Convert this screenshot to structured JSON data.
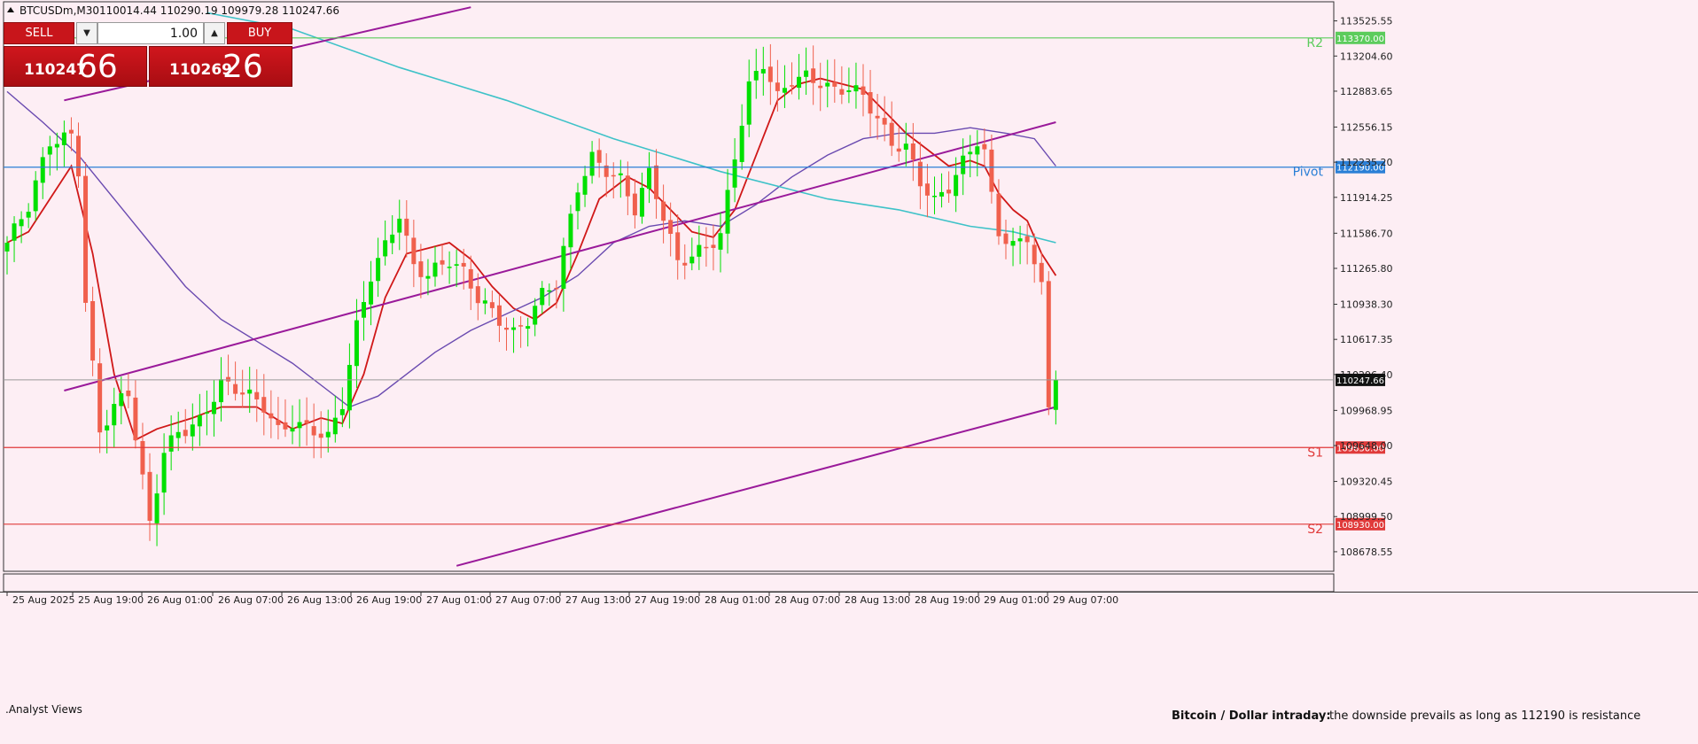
{
  "header": {
    "symbol": "BTCUSDm,M30",
    "ohlc": "110014.44 110290.19 109979.28 110247.66"
  },
  "trade_panel": {
    "sell_label": "SELL",
    "buy_label": "BUY",
    "lot": "1.00",
    "sell_small": "110247",
    "sell_big": "66",
    "buy_small": "110269",
    "buy_big": "26"
  },
  "indicator_label": ".Analyst Views",
  "footer": {
    "title": "Bitcoin / Dollar intraday:",
    "text": "the downside prevails as long as 112190 is resistance"
  },
  "colors": {
    "background": "#fdeef4",
    "bull": "#00e000",
    "bear": "#f0604d",
    "ema_fast": "#d01818",
    "ma_mid": "#6a4ab0",
    "ma_slow": "#3ec2c8",
    "channel": "#9a1a9a",
    "r2": "#5ccc5c",
    "pivot": "#2a7fd6",
    "support": "#e03a3a"
  },
  "chart_data": {
    "type": "candlestick",
    "symbol": "BTCUSDm",
    "timeframe": "M30",
    "ylim": [
      108500,
      113700
    ],
    "y_ticks": [
      "113525.55",
      "113204.60",
      "112883.65",
      "112556.15",
      "112235.20",
      "111914.25",
      "111586.70",
      "111265.80",
      "110938.30",
      "110617.35",
      "110296.40",
      "109968.95",
      "109648.00",
      "109320.45",
      "108999.50",
      "108678.55"
    ],
    "x_ticks": [
      "25 Aug 2025",
      "25 Aug 19:00",
      "26 Aug 01:00",
      "26 Aug 07:00",
      "26 Aug 13:00",
      "26 Aug 19:00",
      "27 Aug 01:00",
      "27 Aug 07:00",
      "27 Aug 13:00",
      "27 Aug 19:00",
      "28 Aug 01:00",
      "28 Aug 07:00",
      "28 Aug 13:00",
      "28 Aug 19:00",
      "29 Aug 01:00",
      "29 Aug 07:00"
    ],
    "last_price": "110247.66",
    "levels": [
      {
        "name": "R2",
        "value": 113370.0,
        "label": "113370.00",
        "color": "#5ccc5c"
      },
      {
        "name": "Pivot",
        "value": 112190.0,
        "label": "112190.00",
        "color": "#2a7fd6"
      },
      {
        "name": "S1",
        "value": 109630.0,
        "label": "109630.00",
        "color": "#e03a3a"
      },
      {
        "name": "S2",
        "value": 108930.0,
        "label": "108930.00",
        "color": "#e03a3a"
      }
    ],
    "candles_count": 148,
    "anchors": [
      [
        0,
        111500
      ],
      [
        3,
        111800
      ],
      [
        6,
        112400
      ],
      [
        9,
        112500
      ],
      [
        10,
        112200
      ],
      [
        11,
        111000
      ],
      [
        12,
        110400
      ],
      [
        13,
        109800
      ],
      [
        15,
        110000
      ],
      [
        17,
        110100
      ],
      [
        19,
        109300
      ],
      [
        20,
        108900
      ],
      [
        22,
        109600
      ],
      [
        24,
        109800
      ],
      [
        27,
        109900
      ],
      [
        30,
        110200
      ],
      [
        33,
        110100
      ],
      [
        36,
        110000
      ],
      [
        38,
        109800
      ],
      [
        40,
        109900
      ],
      [
        43,
        109800
      ],
      [
        45,
        109700
      ],
      [
        47,
        110000
      ],
      [
        49,
        110700
      ],
      [
        51,
        111200
      ],
      [
        53,
        111500
      ],
      [
        55,
        111800
      ],
      [
        57,
        111300
      ],
      [
        59,
        111200
      ],
      [
        62,
        111300
      ],
      [
        64,
        111200
      ],
      [
        66,
        111000
      ],
      [
        68,
        110900
      ],
      [
        71,
        110700
      ],
      [
        73,
        110800
      ],
      [
        75,
        111000
      ],
      [
        77,
        111100
      ],
      [
        80,
        112000
      ],
      [
        82,
        112300
      ],
      [
        84,
        112200
      ],
      [
        86,
        112100
      ],
      [
        88,
        111800
      ],
      [
        90,
        112100
      ],
      [
        92,
        111700
      ],
      [
        94,
        111300
      ],
      [
        96,
        111400
      ],
      [
        98,
        111500
      ],
      [
        100,
        111600
      ],
      [
        102,
        112300
      ],
      [
        104,
        112900
      ],
      [
        106,
        113100
      ],
      [
        108,
        112800
      ],
      [
        110,
        113000
      ],
      [
        112,
        113050
      ],
      [
        114,
        113000
      ],
      [
        116,
        112900
      ],
      [
        118,
        112900
      ],
      [
        120,
        112800
      ],
      [
        122,
        112600
      ],
      [
        124,
        112400
      ],
      [
        126,
        112400
      ],
      [
        128,
        112100
      ],
      [
        130,
        111900
      ],
      [
        132,
        112000
      ],
      [
        134,
        112200
      ],
      [
        136,
        112400
      ],
      [
        137,
        112300
      ],
      [
        138,
        111900
      ],
      [
        139,
        111600
      ],
      [
        141,
        111500
      ],
      [
        143,
        111600
      ],
      [
        145,
        111100
      ],
      [
        146,
        110000
      ],
      [
        147,
        110247.66
      ]
    ],
    "series": [
      {
        "id": "ema_fast",
        "color": "#d01818",
        "values": [
          [
            0,
            111500
          ],
          [
            3,
            111600
          ],
          [
            6,
            111900
          ],
          [
            9,
            112200
          ],
          [
            12,
            111400
          ],
          [
            15,
            110300
          ],
          [
            18,
            109700
          ],
          [
            21,
            109800
          ],
          [
            26,
            109900
          ],
          [
            30,
            110000
          ],
          [
            35,
            110000
          ],
          [
            40,
            109800
          ],
          [
            44,
            109900
          ],
          [
            47,
            109850
          ],
          [
            50,
            110300
          ],
          [
            53,
            111000
          ],
          [
            56,
            111400
          ],
          [
            59,
            111450
          ],
          [
            62,
            111500
          ],
          [
            65,
            111350
          ],
          [
            68,
            111100
          ],
          [
            71,
            110900
          ],
          [
            74,
            110800
          ],
          [
            77,
            110950
          ],
          [
            80,
            111400
          ],
          [
            83,
            111900
          ],
          [
            87,
            112100
          ],
          [
            90,
            112000
          ],
          [
            93,
            111800
          ],
          [
            96,
            111600
          ],
          [
            99,
            111550
          ],
          [
            102,
            111800
          ],
          [
            105,
            112300
          ],
          [
            108,
            112800
          ],
          [
            111,
            112950
          ],
          [
            114,
            113000
          ],
          [
            117,
            112950
          ],
          [
            120,
            112900
          ],
          [
            123,
            112700
          ],
          [
            126,
            112500
          ],
          [
            129,
            112350
          ],
          [
            132,
            112200
          ],
          [
            135,
            112250
          ],
          [
            137,
            112200
          ],
          [
            139,
            111950
          ],
          [
            141,
            111800
          ],
          [
            143,
            111700
          ],
          [
            145,
            111400
          ],
          [
            147,
            111200
          ]
        ]
      },
      {
        "id": "ma_mid",
        "color": "#6a4ab0",
        "values": [
          [
            0,
            112880
          ],
          [
            5,
            112600
          ],
          [
            10,
            112300
          ],
          [
            15,
            111900
          ],
          [
            20,
            111500
          ],
          [
            25,
            111100
          ],
          [
            30,
            110800
          ],
          [
            35,
            110600
          ],
          [
            40,
            110400
          ],
          [
            45,
            110150
          ],
          [
            48,
            110000
          ],
          [
            52,
            110100
          ],
          [
            56,
            110300
          ],
          [
            60,
            110500
          ],
          [
            65,
            110700
          ],
          [
            70,
            110850
          ],
          [
            75,
            111000
          ],
          [
            80,
            111200
          ],
          [
            85,
            111500
          ],
          [
            90,
            111650
          ],
          [
            95,
            111700
          ],
          [
            100,
            111650
          ],
          [
            105,
            111850
          ],
          [
            110,
            112100
          ],
          [
            115,
            112300
          ],
          [
            120,
            112450
          ],
          [
            125,
            112500
          ],
          [
            130,
            112500
          ],
          [
            135,
            112550
          ],
          [
            140,
            112500
          ],
          [
            144,
            112450
          ],
          [
            147,
            112200
          ]
        ]
      },
      {
        "id": "ma_slow",
        "color": "#3ec2c8",
        "values": [
          [
            28,
            113600
          ],
          [
            40,
            113450
          ],
          [
            55,
            113100
          ],
          [
            70,
            112800
          ],
          [
            85,
            112450
          ],
          [
            100,
            112150
          ],
          [
            115,
            111900
          ],
          [
            125,
            111800
          ],
          [
            135,
            111650
          ],
          [
            141,
            111600
          ],
          [
            147,
            111500
          ]
        ]
      },
      {
        "id": "channel_upper",
        "color": "#9a1a9a",
        "values": [
          [
            8,
            112800
          ],
          [
            65,
            113650
          ]
        ]
      },
      {
        "id": "channel_mid",
        "color": "#9a1a9a",
        "values": [
          [
            8,
            110150
          ],
          [
            147,
            112600
          ]
        ]
      },
      {
        "id": "channel_lower",
        "color": "#9a1a9a",
        "values": [
          [
            63,
            108550
          ],
          [
            147,
            110000
          ]
        ]
      }
    ]
  }
}
